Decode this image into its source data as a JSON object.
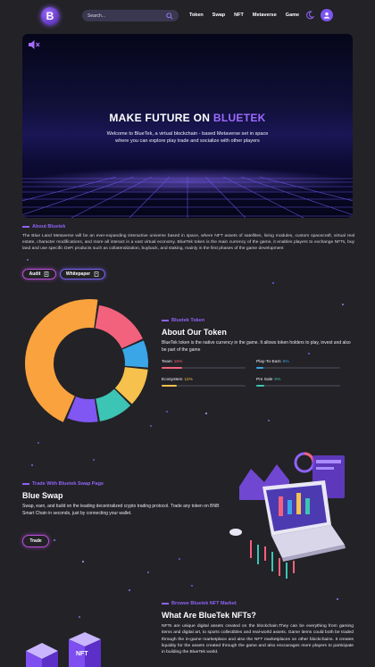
{
  "nav": {
    "logo_letter": "B",
    "search_placeholder": "Search...",
    "menu": [
      "Token",
      "Swap",
      "NFT",
      "Metaverse",
      "Game"
    ]
  },
  "hero": {
    "title_main": "MAKE FUTURE ON ",
    "title_accent": "BLUETEK",
    "description": "Welcome to BlueTek, a virtual blockchain - based Metaverse set in space where you can explore play trade and socialize with other players"
  },
  "about": {
    "label": "About Bluetek",
    "text": "The Blue Land Metaverse will be an ever-expanding interactive universe based in space, where NFT assets of satellites, living modules, custom spacecraft, virtual real estate, character modifications, and more all interact in a vast virtual economy. BlueTek token is the main currency of the game, it enables players to exchange NFTs, buy land and use specific DeFi products such as collateralization, buyback, and staking, mainly in the first phases of the game development",
    "buttons": [
      "Audit",
      "Whitepaper"
    ]
  },
  "token": {
    "label": "Bluetek Token",
    "title": "About Our Token",
    "text": "BlueTek token is the native currency in the game. It allows token holders to play, invest and also be part of the game",
    "allocations": [
      {
        "name": "Team",
        "pct": "15%",
        "value": 0.15,
        "color": "#f2627d"
      },
      {
        "name": "Play-To-Earn",
        "pct": "5%",
        "value": 0.05,
        "color": "#3aa6e8"
      },
      {
        "name": "Ecosystem",
        "pct": "11%",
        "value": 0.11,
        "color": "#f6c14c"
      },
      {
        "name": "Pre Sale",
        "pct": "6%",
        "value": 0.06,
        "color": "#3cc4b4"
      }
    ],
    "donut_segments": [
      {
        "color": "#f2627d",
        "value": 16
      },
      {
        "color": "#3aa6e8",
        "value": 8
      },
      {
        "color": "#f6c14c",
        "value": 11
      },
      {
        "color": "#3cc4b4",
        "value": 10
      },
      {
        "color": "#8057f2",
        "value": 9
      },
      {
        "color": "#f9a23e",
        "value": 46
      }
    ]
  },
  "swap": {
    "label": "Trade With Bluetek Swap Page",
    "title": "Blue Swap",
    "text": "Swap, earn, and build on the leading decentralized crypto trading protocol. Trade any token on BNB Smart Chain in seconds, just by connecting your wallet.",
    "button": "Trade"
  },
  "nft": {
    "label": "Browse Bluetek NFT Market",
    "title": "What Are BlueTek NFTs?",
    "text": "NFTs are unique digital assets created on the blockchain.They can be everything from gaming items and digital art, to sports collectibles and real-world assets. Game items could both be traded through the in-game marketplace and also the NFT marketplaces on other blockchains. It creates liquidity for the assets created through the game and also encourages more players to participate in building the BlueTek world.",
    "box_label": "NFT"
  }
}
